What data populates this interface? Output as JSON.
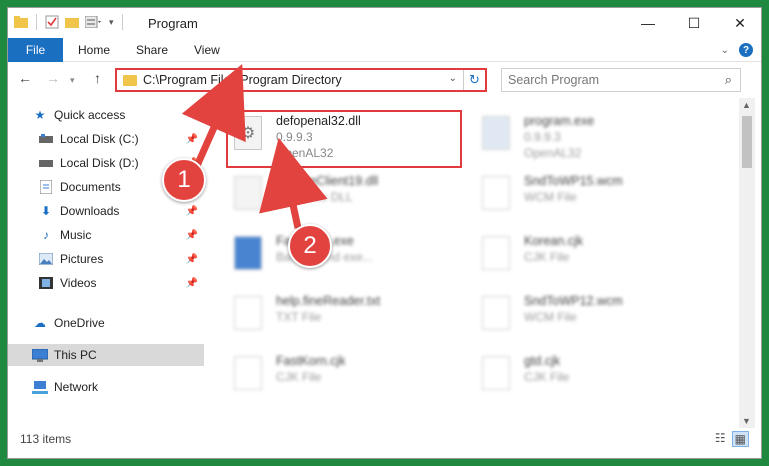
{
  "window": {
    "title": "Program",
    "controls": {
      "minimize": "—",
      "maximize": "☐",
      "close": "✕"
    }
  },
  "ribbon": {
    "tabs": [
      {
        "label": "File",
        "active": true
      },
      {
        "label": "Home"
      },
      {
        "label": "Share"
      },
      {
        "label": "View"
      }
    ],
    "help": "?"
  },
  "nav": {
    "address_path": "C:\\Program Files\\Program Directory",
    "search_placeholder": "Search Program"
  },
  "sidebar": {
    "items": [
      {
        "label": "Quick access",
        "icon": "star-icon",
        "pinned": false
      },
      {
        "label": "Local Disk (C:)",
        "icon": "drive-icon",
        "pinned": true
      },
      {
        "label": "Local Disk (D:)",
        "icon": "drive-icon",
        "pinned": true
      },
      {
        "label": "Documents",
        "icon": "document-icon",
        "pinned": true
      },
      {
        "label": "Downloads",
        "icon": "download-icon",
        "pinned": true
      },
      {
        "label": "Music",
        "icon": "music-icon",
        "pinned": true
      },
      {
        "label": "Pictures",
        "icon": "picture-icon",
        "pinned": true
      },
      {
        "label": "Videos",
        "icon": "video-icon",
        "pinned": true
      },
      {
        "label": "OneDrive",
        "icon": "cloud-icon",
        "pinned": false
      },
      {
        "label": "This PC",
        "icon": "pc-icon",
        "selected": true
      },
      {
        "label": "Network",
        "icon": "network-icon",
        "pinned": false
      }
    ]
  },
  "files": [
    {
      "name": "defopenal32.dll",
      "line1": "0.9.9.3",
      "line2": "OpenAL32",
      "highlighted": true,
      "blurred": false
    },
    {
      "name": "program.exe",
      "line1": "0.9.9.3",
      "line2": "OpenAL32",
      "blurred": true
    },
    {
      "name": "UpdateClient19.dll",
      "line1": "Resource DLL",
      "line2": "",
      "blurred": true
    },
    {
      "name": "SndToWP15.wcm",
      "line1": "WCM File",
      "line2": "",
      "blurred": true
    },
    {
      "name": "Faceexec.exe",
      "line1": "Background exe...",
      "line2": "",
      "blurred": true
    },
    {
      "name": "Korean.cjk",
      "line1": "CJK File",
      "line2": "",
      "blurred": true
    },
    {
      "name": "help.fineReader.txt",
      "line1": "TXT File",
      "line2": "",
      "blurred": true
    },
    {
      "name": "SndToWP12.wcm",
      "line1": "WCM File",
      "line2": "",
      "blurred": true
    },
    {
      "name": "FastKorn.cjk",
      "line1": "CJK File",
      "line2": "",
      "blurred": true
    },
    {
      "name": "gtd.cjk",
      "line1": "CJK File",
      "line2": "",
      "blurred": true
    }
  ],
  "status": {
    "item_count": "113 items"
  },
  "callouts": [
    "1",
    "2"
  ],
  "colors": {
    "accent": "#1a6fc0",
    "highlight": "#e0393e",
    "background": "#1f8a3f"
  }
}
